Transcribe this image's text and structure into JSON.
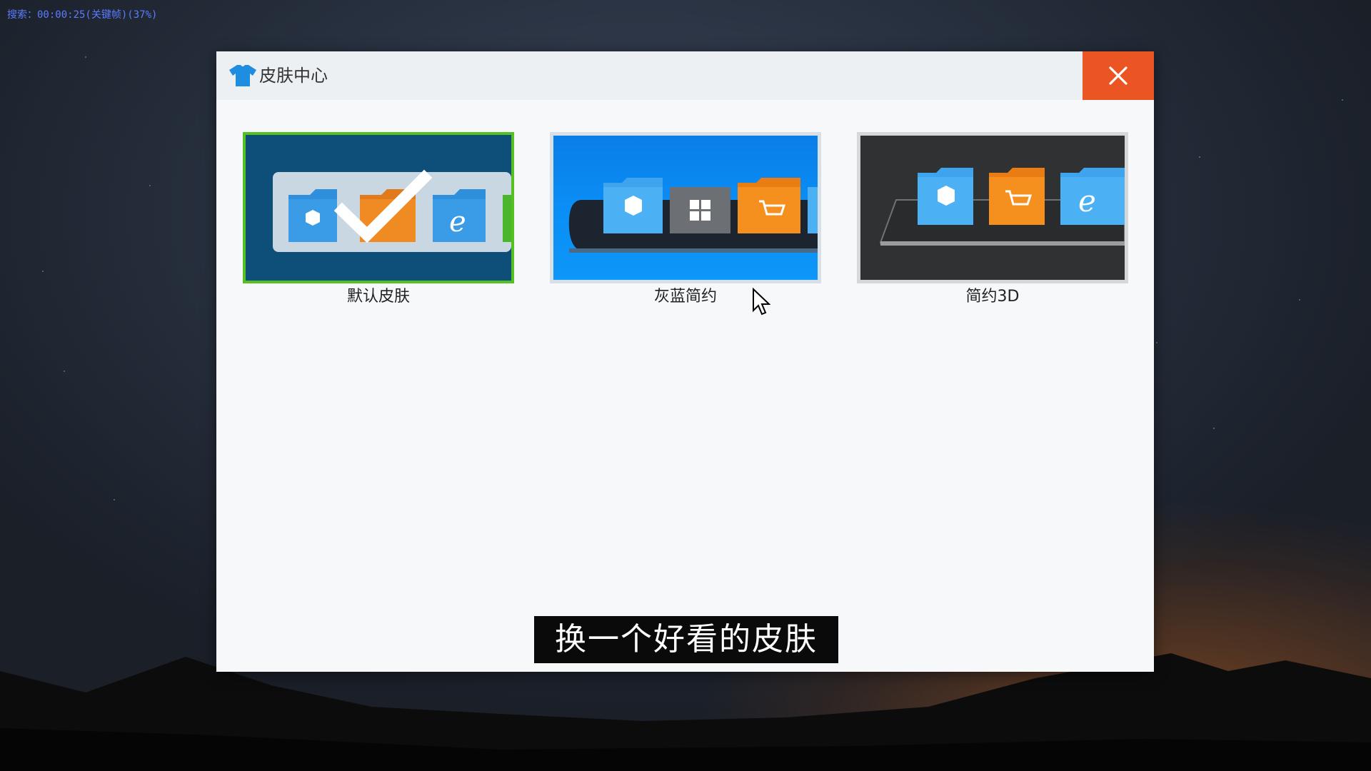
{
  "overlay": {
    "status_text": "搜索：00:00:25(关键帧)(37%)"
  },
  "window": {
    "title": "皮肤中心",
    "icon": "tshirt-icon",
    "close_icon": "close-icon"
  },
  "skins": [
    {
      "label": "默认皮肤",
      "selected": true
    },
    {
      "label": "灰蓝简约",
      "selected": false
    },
    {
      "label": "简约3D",
      "selected": false
    }
  ],
  "subtitle": "换一个好看的皮肤",
  "colors": {
    "close_button": "#ea5523",
    "selected_border": "#55c022",
    "folder_blue": "#2f8fdc",
    "folder_orange": "#f08a22"
  }
}
